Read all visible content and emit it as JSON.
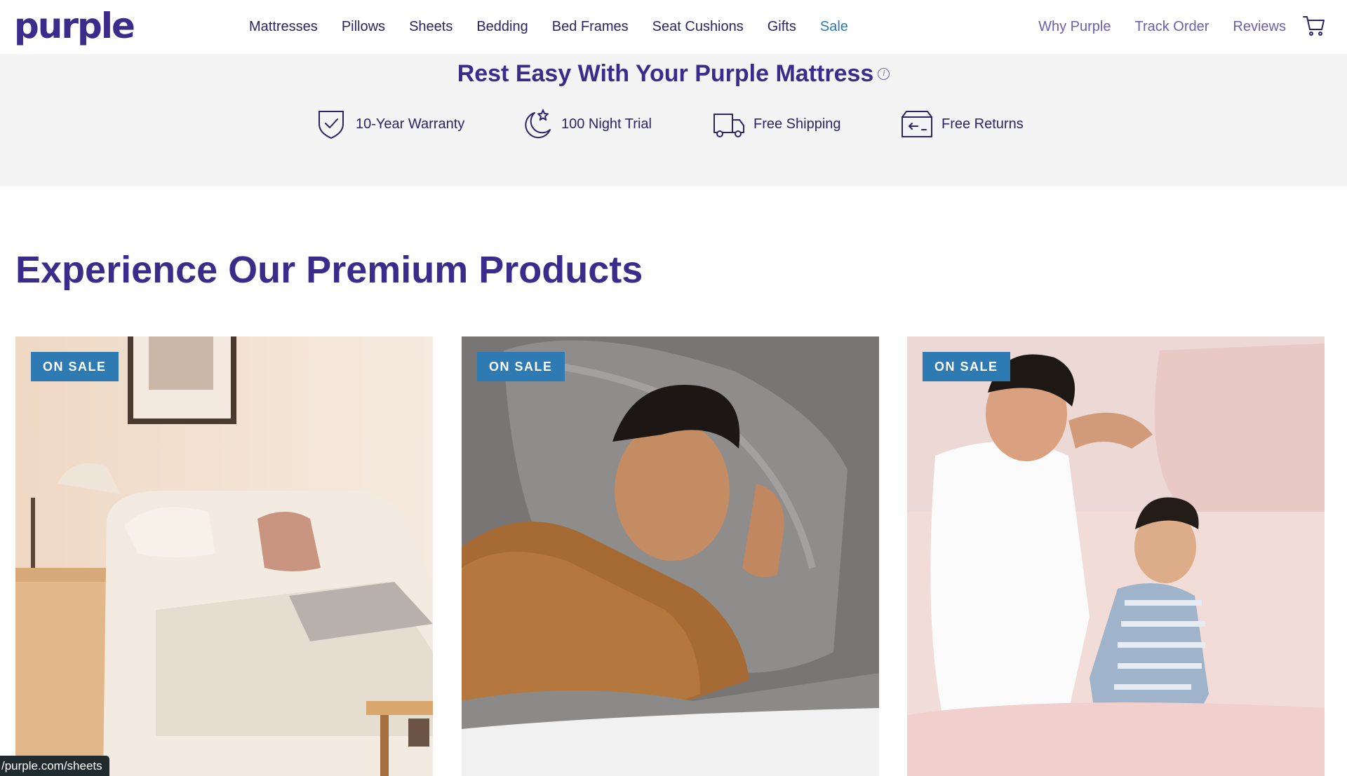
{
  "header": {
    "logo": "purple",
    "nav": [
      "Mattresses",
      "Pillows",
      "Sheets",
      "Bedding",
      "Bed Frames",
      "Seat Cushions",
      "Gifts",
      "Sale"
    ],
    "utility": [
      "Why Purple",
      "Track Order",
      "Reviews"
    ],
    "cart_icon": "cart-icon"
  },
  "promise": {
    "title": "Rest Easy With Your Purple Mattress",
    "info_icon": "info-icon",
    "benefits": [
      {
        "label": "10-Year Warranty",
        "icon": "shield-check-icon"
      },
      {
        "label": "100 Night Trial",
        "icon": "moon-star-icon"
      },
      {
        "label": "Free Shipping",
        "icon": "truck-icon"
      },
      {
        "label": "Free Returns",
        "icon": "return-box-icon"
      }
    ]
  },
  "products": {
    "heading": "Experience Our Premium Products",
    "cards": [
      {
        "badge": "ON SALE",
        "image": "bedroom-adjustable-bed-photo"
      },
      {
        "badge": "ON SALE",
        "image": "man-sleeping-on-pillow-photo"
      },
      {
        "badge": "ON SALE",
        "image": "father-and-son-in-bed-photo"
      }
    ]
  },
  "status_bar": {
    "url": "/purple.com/sheets"
  },
  "colors": {
    "brand_purple": "#3b2c8c",
    "nav_text": "#2b2467",
    "sale_blue": "#2e7ab2",
    "promise_bg": "#f4f4f4"
  }
}
